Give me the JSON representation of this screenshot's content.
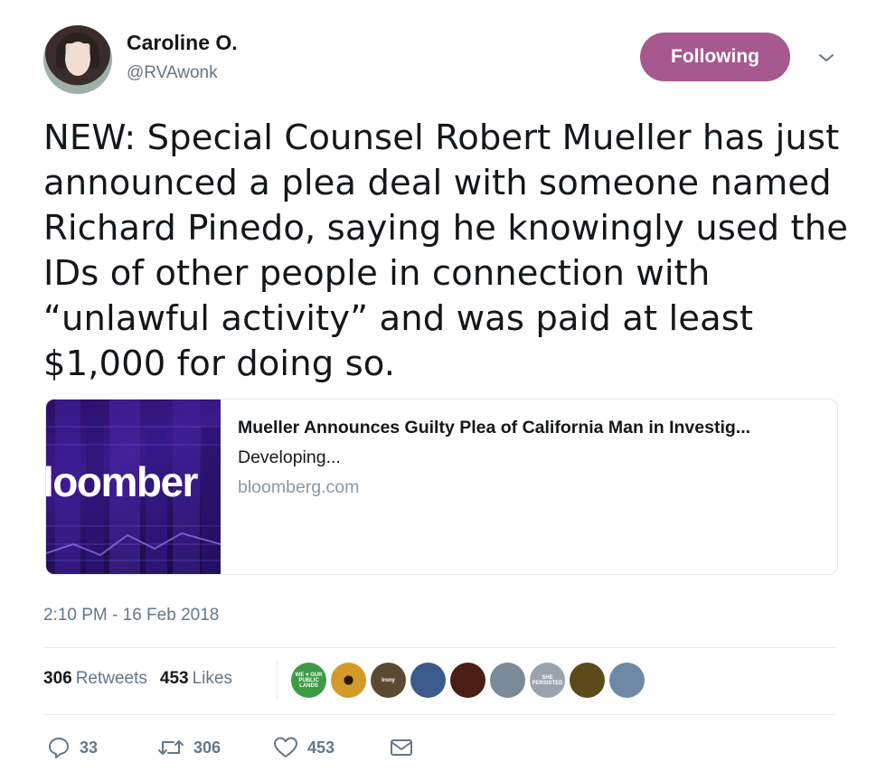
{
  "author": {
    "name": "Caroline O.",
    "handle": "@RVAwonk"
  },
  "follow_button": {
    "label": "Following",
    "color": "#a7588f"
  },
  "tweet": {
    "text": "NEW: Special Counsel Robert Mueller has just announced a plea deal with someone named Richard Pinedo, saying he knowingly used the IDs of other people in connection with “unlawful activity” and was paid at least $1,000 for doing so."
  },
  "card": {
    "image_text": "loomber",
    "title": "Mueller Announces Guilty Plea of California Man in Investig...",
    "description": "Developing...",
    "domain": "bloomberg.com"
  },
  "timestamp": "2:10 PM - 16 Feb 2018",
  "stats": {
    "retweets_count": "306",
    "retweets_label": "Retweets",
    "likes_count": "453",
    "likes_label": "Likes"
  },
  "likers": [
    {
      "label": "WE ♥ OUR PUBLIC LANDS",
      "color": "#3d9a45"
    },
    {
      "label": "",
      "color": "#c8861c"
    },
    {
      "label": "Irony",
      "color": "#5b4a33"
    },
    {
      "label": "",
      "color": "#3b5b8c"
    },
    {
      "label": "",
      "color": "#4a1e14"
    },
    {
      "label": "",
      "color": "#7a8a99"
    },
    {
      "label": "SHE PERSISTED",
      "color": "#9aa3ad"
    },
    {
      "label": "",
      "color": "#5c4a1a"
    },
    {
      "label": "",
      "color": "#6d89a6"
    }
  ],
  "actions": {
    "reply_count": "33",
    "retweet_count": "306",
    "like_count": "453"
  },
  "icons": {
    "chevron": "chevron-down-icon",
    "reply": "reply-icon",
    "retweet": "retweet-icon",
    "like": "heart-icon",
    "dm": "envelope-icon"
  },
  "colors": {
    "text": "#14171a",
    "secondary": "#657786",
    "divider": "#e6ecf0"
  }
}
